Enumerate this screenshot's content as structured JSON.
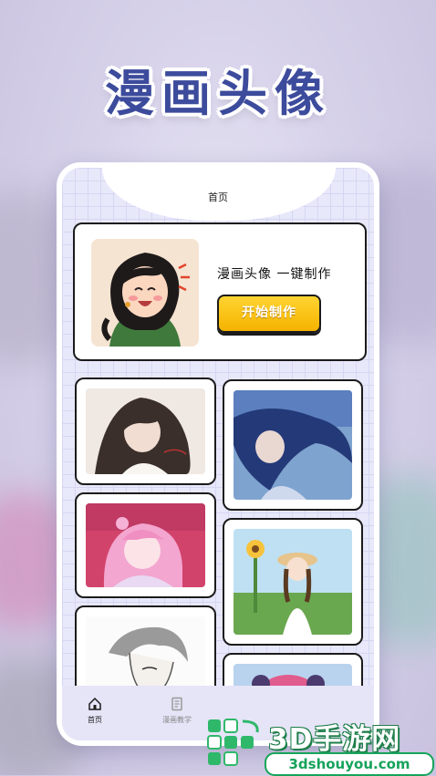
{
  "headline": "漫画头像",
  "app": {
    "nav_title": "首页",
    "hero": {
      "tagline": "漫画头像  一键制作",
      "start_button": "开始制作"
    },
    "tabs": [
      {
        "label": "首页",
        "icon": "home-icon",
        "active": true
      },
      {
        "label": "漫画教学",
        "icon": "book-icon",
        "active": false
      }
    ]
  },
  "watermark": {
    "brand": "3D手游网",
    "url": "3dshouyou.com"
  },
  "colors": {
    "headline": "#3c4b9c",
    "button": "#f5b300",
    "app_bg": "#e8e8fb",
    "watermark_green": "#16a45a"
  }
}
